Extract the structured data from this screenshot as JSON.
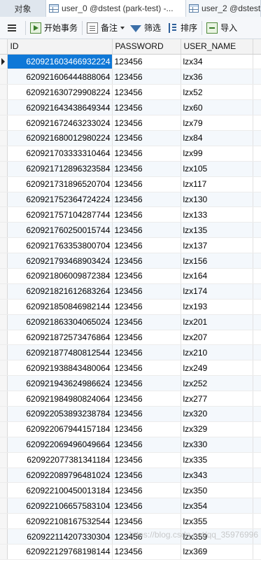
{
  "tabs": [
    {
      "label": "对象"
    },
    {
      "label": "user_0 @dstest (park-test) -..."
    },
    {
      "label": "user_2 @dstest"
    }
  ],
  "toolbar": {
    "begin_transaction": "开始事务",
    "note": "备注",
    "filter": "筛选",
    "sort": "排序",
    "import": "导入"
  },
  "table": {
    "columns": [
      "ID",
      "PASSWORD",
      "USER_NAME"
    ],
    "rows": [
      {
        "id": "620921603466932224",
        "password": "123456",
        "user_name": "lzx34"
      },
      {
        "id": "620921606444888064",
        "password": "123456",
        "user_name": "lzx36"
      },
      {
        "id": "620921630729908224",
        "password": "123456",
        "user_name": "lzx52"
      },
      {
        "id": "620921643438649344",
        "password": "123456",
        "user_name": "lzx60"
      },
      {
        "id": "620921672463233024",
        "password": "123456",
        "user_name": "lzx79"
      },
      {
        "id": "620921680012980224",
        "password": "123456",
        "user_name": "lzx84"
      },
      {
        "id": "620921703333310464",
        "password": "123456",
        "user_name": "lzx99"
      },
      {
        "id": "620921712896323584",
        "password": "123456",
        "user_name": "lzx105"
      },
      {
        "id": "620921731896520704",
        "password": "123456",
        "user_name": "lzx117"
      },
      {
        "id": "620921752364724224",
        "password": "123456",
        "user_name": "lzx130"
      },
      {
        "id": "620921757104287744",
        "password": "123456",
        "user_name": "lzx133"
      },
      {
        "id": "620921760250015744",
        "password": "123456",
        "user_name": "lzx135"
      },
      {
        "id": "620921763353800704",
        "password": "123456",
        "user_name": "lzx137"
      },
      {
        "id": "620921793468903424",
        "password": "123456",
        "user_name": "lzx156"
      },
      {
        "id": "620921806009872384",
        "password": "123456",
        "user_name": "lzx164"
      },
      {
        "id": "620921821612683264",
        "password": "123456",
        "user_name": "lzx174"
      },
      {
        "id": "620921850846982144",
        "password": "123456",
        "user_name": "lzx193"
      },
      {
        "id": "620921863304065024",
        "password": "123456",
        "user_name": "lzx201"
      },
      {
        "id": "620921872573476864",
        "password": "123456",
        "user_name": "lzx207"
      },
      {
        "id": "620921877480812544",
        "password": "123456",
        "user_name": "lzx210"
      },
      {
        "id": "620921938843480064",
        "password": "123456",
        "user_name": "lzx249"
      },
      {
        "id": "620921943624986624",
        "password": "123456",
        "user_name": "lzx252"
      },
      {
        "id": "620921984980824064",
        "password": "123456",
        "user_name": "lzx277"
      },
      {
        "id": "620922053893238784",
        "password": "123456",
        "user_name": "lzx320"
      },
      {
        "id": "620922067944157184",
        "password": "123456",
        "user_name": "lzx329"
      },
      {
        "id": "620922069496049664",
        "password": "123456",
        "user_name": "lzx330"
      },
      {
        "id": "620922077381341184",
        "password": "123456",
        "user_name": "lzx335"
      },
      {
        "id": "620922089796481024",
        "password": "123456",
        "user_name": "lzx343"
      },
      {
        "id": "620922100450013184",
        "password": "123456",
        "user_name": "lzx350"
      },
      {
        "id": "620922106657583104",
        "password": "123456",
        "user_name": "lzx354"
      },
      {
        "id": "620922108167532544",
        "password": "123456",
        "user_name": "lzx355"
      },
      {
        "id": "620922114207330304",
        "password": "123456",
        "user_name": "lzx359"
      },
      {
        "id": "620922129768198144",
        "password": "123456",
        "user_name": "lzx369"
      }
    ]
  },
  "watermark": "https://blog.csdn.net/qq_35976996"
}
